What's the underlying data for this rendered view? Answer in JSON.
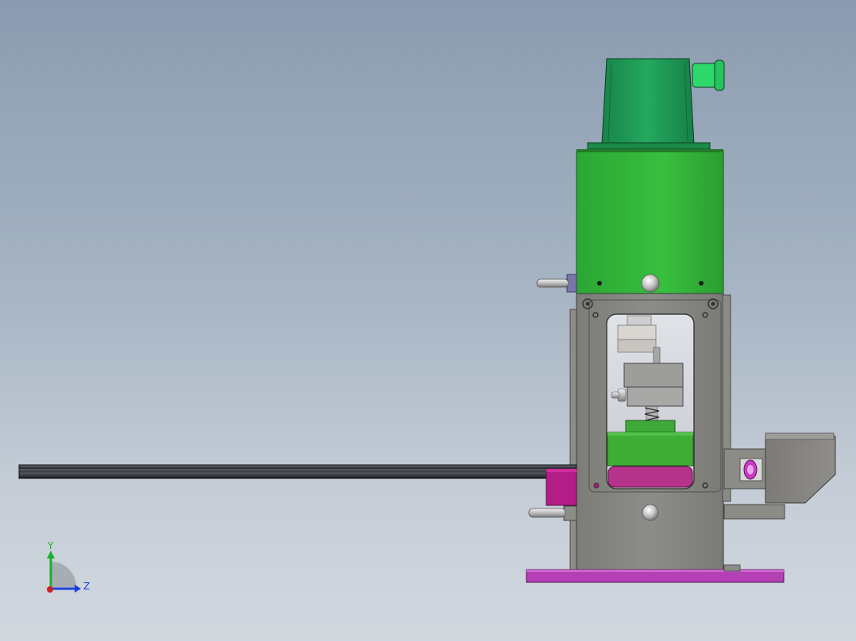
{
  "viewport": {
    "background_top": "#8a9cb0",
    "background_bottom": "#d2d8df"
  },
  "model": {
    "parts": [
      "motor",
      "motor-connector",
      "upper-housing",
      "frame",
      "window",
      "spindle",
      "spring",
      "clamp-block",
      "green-plate",
      "magenta-plate",
      "guide-rail",
      "magenta-block",
      "side-bracket",
      "roller",
      "base-plate",
      "handle-upper",
      "handle-lower"
    ],
    "colors": {
      "motor": "#1e9e55",
      "housing": "#2fb538",
      "frame": "#878782",
      "base": "#b03ab0",
      "magenta": "#b01a85",
      "rail": "#2a2e34",
      "bracket": "#8a8884"
    }
  },
  "triad": {
    "y_label": "Y",
    "z_label": "Z",
    "colors": {
      "x": "#d2202a",
      "y": "#1bb02a",
      "z": "#1a3fd8"
    }
  }
}
